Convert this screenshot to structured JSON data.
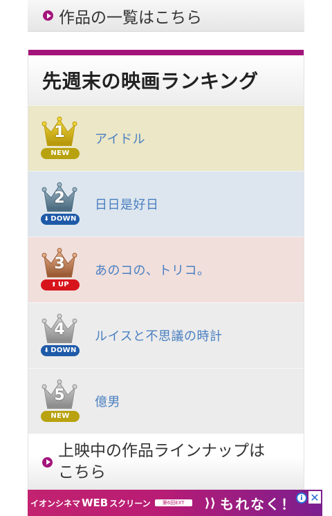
{
  "top_link": {
    "label": "作品の一覧はこちら"
  },
  "ranking": {
    "title": "先週末の映画ランキング",
    "accent_color": "#a3157b",
    "items": [
      {
        "rank": "1",
        "tag": "NEW",
        "tag_arrow": "",
        "title": "アイドル",
        "row_color": "#ebe7c7",
        "crown": "gold",
        "tag_color": "#b9a20f"
      },
      {
        "rank": "2",
        "tag": "DOWN",
        "tag_arrow": "⬇",
        "title": "日日是好日",
        "row_color": "#dde6ee",
        "crown": "blue",
        "tag_color": "#1e5aa8"
      },
      {
        "rank": "3",
        "tag": "UP",
        "tag_arrow": "⬆",
        "title": "あのコの、トリコ。",
        "row_color": "#f1dfdc",
        "crown": "bronze",
        "tag_color": "#d7141c"
      },
      {
        "rank": "4",
        "tag": "DOWN",
        "tag_arrow": "⬇",
        "title": "ルイスと不思議の時計",
        "row_color": "#ececec",
        "crown": "silver",
        "tag_color": "#1e5aa8"
      },
      {
        "rank": "5",
        "tag": "NEW",
        "tag_arrow": "",
        "title": "億男",
        "row_color": "#ececec",
        "crown": "silver",
        "tag_color": "#b9a20f"
      }
    ]
  },
  "lineup_link": {
    "label": "上映中の作品ラインナップはこちら"
  },
  "ad": {
    "brand_prefix": "イオンシネマ",
    "brand_main": "WEB",
    "brand_suffix": "スクリーン",
    "mini_badge": "第6回EXT",
    "copy": "もれなく！",
    "info_label": "i",
    "close_label": "✕"
  }
}
